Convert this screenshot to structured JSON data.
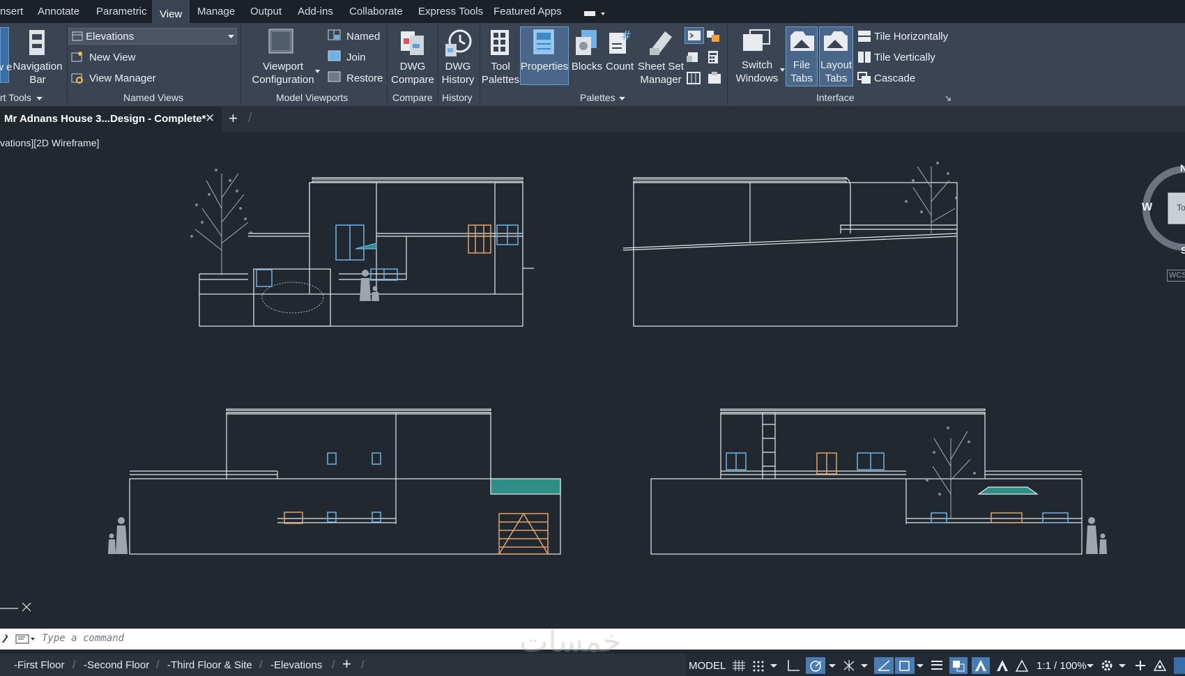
{
  "ribbon_tabs": [
    "nsert",
    "Annotate",
    "Parametric",
    "View",
    "Manage",
    "Output",
    "Add-ins",
    "Collaborate",
    "Express Tools",
    "Featured Apps"
  ],
  "active_tab": "View",
  "panels": {
    "viewport_tools": {
      "label": "rt Tools",
      "buttons": [
        "w\ne",
        "Navigation\nBar"
      ]
    },
    "named_views": {
      "label": "Named Views",
      "dropdown_value": "Elevations",
      "items": [
        "New View",
        "View Manager"
      ]
    },
    "model_viewports": {
      "label": "Model Viewports",
      "config_button": "Viewport\nConfiguration",
      "items": [
        "Named",
        "Join",
        "Restore"
      ]
    },
    "compare": {
      "label": "Compare",
      "button": "DWG\nCompare"
    },
    "history": {
      "label": "History",
      "button": "DWG\nHistory"
    },
    "palettes": {
      "label": "Palettes",
      "buttons": [
        "Tool\nPalettes",
        "Properties",
        "Blocks",
        "Count",
        "Sheet Set\nManager"
      ]
    },
    "interface": {
      "label": "Interface",
      "buttons": [
        "Switch\nWindows",
        "File\nTabs",
        "Layout\nTabs"
      ],
      "items": [
        "Tile Horizontally",
        "Tile Vertically",
        "Cascade"
      ]
    }
  },
  "file_tab": {
    "title": "Mr Adnans House 3...Design - Complete*"
  },
  "viewport_label": "vations][2D Wireframe]",
  "viewcube": {
    "west": "W",
    "north": "N",
    "south": "S",
    "face": "To",
    "wcs": "WCS"
  },
  "command_placeholder": "Type a command",
  "watermark": "خمسات",
  "layout_tabs": [
    "-First Floor",
    "-Second Floor",
    "-Third Floor & Site",
    "-Elevations"
  ],
  "status": {
    "model": "MODEL",
    "scale": "1:1 / 100%"
  },
  "colors": {
    "canvas": "#212830",
    "ribbon": "#3b4453",
    "line": "#e6e9ec",
    "window_blue": "#6fb2e6",
    "door_orange": "#e0a46d",
    "teal": "#2f8f87"
  }
}
